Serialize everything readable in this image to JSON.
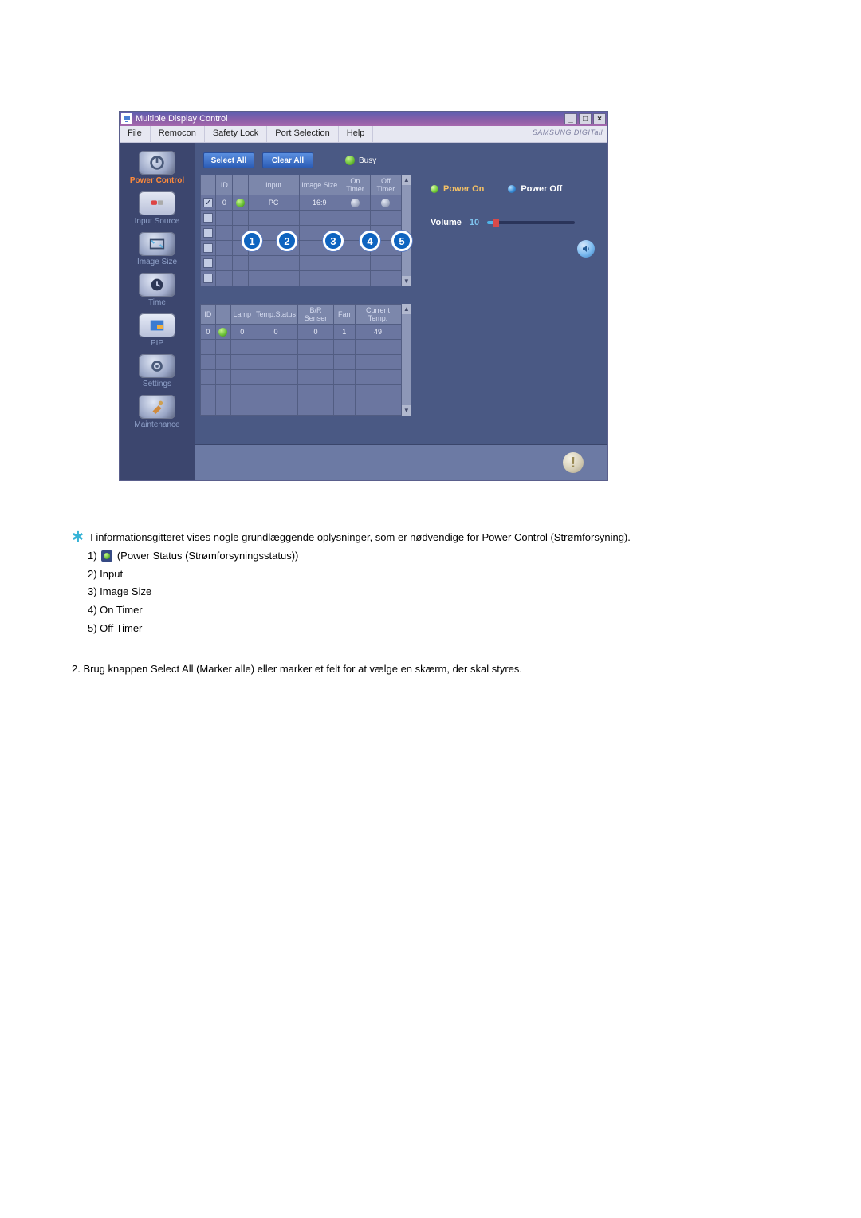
{
  "window": {
    "title": "Multiple Display Control",
    "brand": "SAMSUNG DIGITall"
  },
  "menu": [
    "File",
    "Remocon",
    "Safety Lock",
    "Port Selection",
    "Help"
  ],
  "sidebar": [
    {
      "label": "Power Control",
      "active": true
    },
    {
      "label": "Input Source",
      "active": false
    },
    {
      "label": "Image Size",
      "active": false
    },
    {
      "label": "Time",
      "active": false
    },
    {
      "label": "PIP",
      "active": false
    },
    {
      "label": "Settings",
      "active": false
    },
    {
      "label": "Maintenance",
      "active": false
    }
  ],
  "toolbar": {
    "select_all": "Select All",
    "clear_all": "Clear All",
    "busy": "Busy"
  },
  "grid1": {
    "headers": [
      "",
      "ID",
      "",
      "Input",
      "Image Size",
      "On Timer",
      "Off Timer"
    ],
    "rows": [
      {
        "checked": true,
        "id": "0",
        "led": "green",
        "input": "PC",
        "size": "16:9",
        "on": "grey",
        "off": "grey"
      },
      {
        "checked": false,
        "id": "",
        "led": "",
        "input": "",
        "size": "",
        "on": "",
        "off": ""
      },
      {
        "checked": false,
        "id": "",
        "led": "",
        "input": "",
        "size": "",
        "on": "",
        "off": ""
      },
      {
        "checked": false,
        "id": "",
        "led": "",
        "input": "",
        "size": "",
        "on": "",
        "off": ""
      },
      {
        "checked": false,
        "id": "",
        "led": "",
        "input": "",
        "size": "",
        "on": "",
        "off": ""
      },
      {
        "checked": false,
        "id": "",
        "led": "",
        "input": "",
        "size": "",
        "on": "",
        "off": ""
      }
    ]
  },
  "grid2": {
    "headers": [
      "ID",
      "",
      "Lamp",
      "Temp.Status",
      "B/R Senser",
      "Fan",
      "Current Temp."
    ],
    "rows": [
      {
        "id": "0",
        "led": "green",
        "lamp": "0",
        "temp": "0",
        "br": "0",
        "fan": "1",
        "ct": "49"
      },
      {
        "id": "",
        "led": "",
        "lamp": "",
        "temp": "",
        "br": "",
        "fan": "",
        "ct": ""
      },
      {
        "id": "",
        "led": "",
        "lamp": "",
        "temp": "",
        "br": "",
        "fan": "",
        "ct": ""
      },
      {
        "id": "",
        "led": "",
        "lamp": "",
        "temp": "",
        "br": "",
        "fan": "",
        "ct": ""
      },
      {
        "id": "",
        "led": "",
        "lamp": "",
        "temp": "",
        "br": "",
        "fan": "",
        "ct": ""
      },
      {
        "id": "",
        "led": "",
        "lamp": "",
        "temp": "",
        "br": "",
        "fan": "",
        "ct": ""
      }
    ]
  },
  "right_panel": {
    "power_on": "Power On",
    "power_off": "Power Off",
    "volume_label": "Volume",
    "volume_value": "10",
    "volume_percent": 10
  },
  "callouts": [
    "1",
    "2",
    "3",
    "4",
    "5"
  ],
  "doc": {
    "intro": "I informationsgitteret vises nogle grundlæggende oplysninger, som er nødvendige for Power Control (Strømforsyning).",
    "items": {
      "n1": "1)",
      "t1": " (Power Status (Strømforsyningsstatus))",
      "l2": "2) Input",
      "l3": "3) Image Size",
      "l4": "4) On Timer",
      "l5": "5) Off Timer"
    },
    "para2": "2.  Brug knappen Select All (Marker alle) eller marker et felt for at vælge en skærm, der skal styres."
  }
}
